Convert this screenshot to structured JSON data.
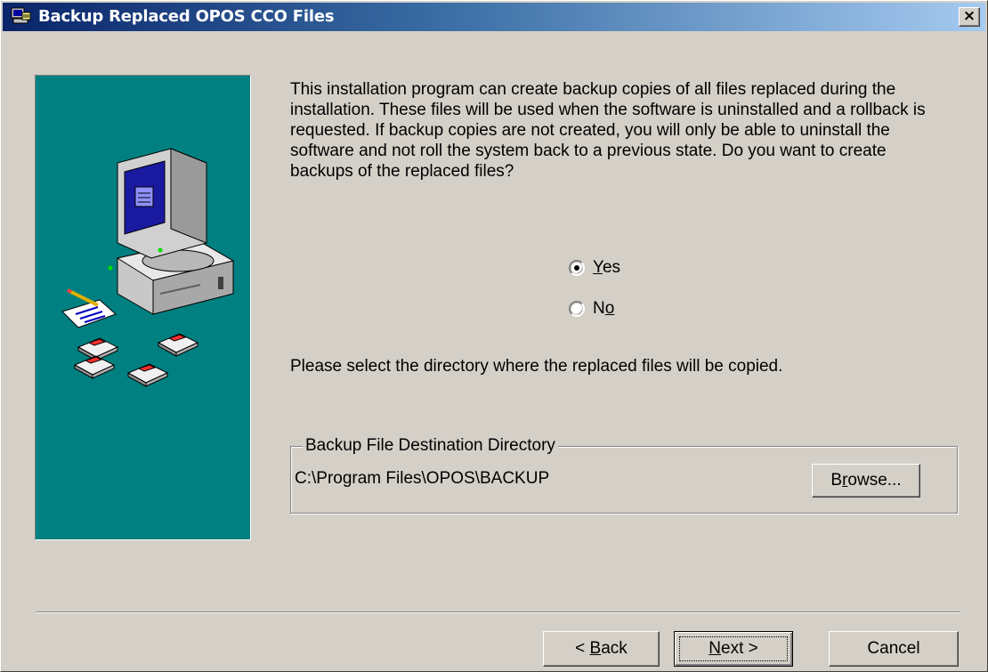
{
  "window": {
    "title": "Backup Replaced OPOS CCO Files",
    "close_label": "×",
    "icon": "setup-app-icon"
  },
  "side_panel": {
    "illustration": "computer-with-disks-illustration",
    "background_color": "#008080"
  },
  "content": {
    "intro": "This installation program can create backup copies of all files replaced during the installation. These files will be used when the software is uninstalled and a rollback is requested.  If backup copies are not created, you will only be able to uninstall the software and not roll the system back to a previous state.  Do you want to create backups of the replaced files?",
    "radio_options": [
      {
        "label_prefix": "",
        "label_mnemonic": "Y",
        "label_suffix": "es",
        "selected": true
      },
      {
        "label_prefix": "N",
        "label_mnemonic": "o",
        "label_suffix": "",
        "selected": false
      }
    ],
    "select_prompt": "Please select the directory where the replaced  files will be copied.",
    "group": {
      "label": "Backup File Destination Directory",
      "path": "C:\\Program Files\\OPOS\\BACKUP",
      "browse": {
        "prefix": "B",
        "mnemonic": "r",
        "suffix": "owse..."
      }
    }
  },
  "footer": {
    "back": {
      "prefix": "< ",
      "mnemonic": "B",
      "suffix": "ack"
    },
    "next": {
      "prefix": "",
      "mnemonic": "N",
      "suffix": "ext >"
    },
    "cancel": "Cancel"
  },
  "colors": {
    "dialog_bg": "#d4d0c8",
    "title_start": "#0a246a",
    "title_end": "#a6caf0",
    "panel": "#008080"
  }
}
